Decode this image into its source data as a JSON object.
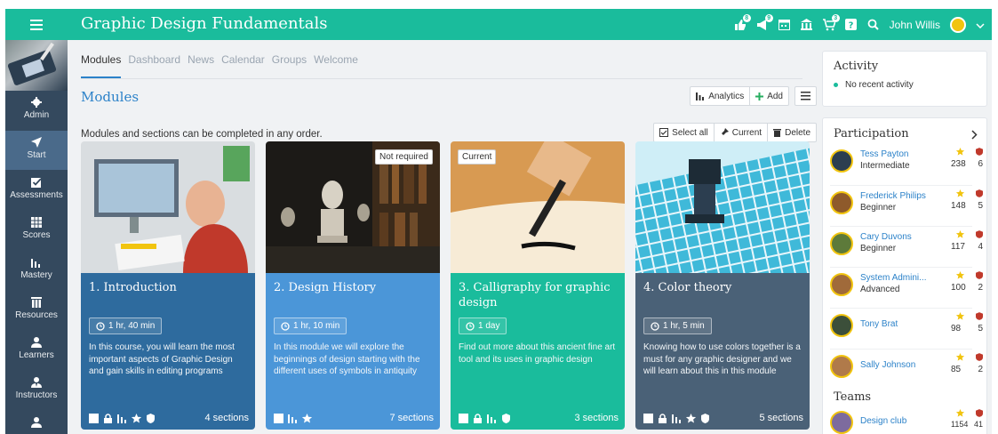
{
  "header": {
    "app_title": "Graphic Design Fundamentals",
    "icon_badges": [
      "8",
      "9",
      "",
      "",
      "3",
      ""
    ],
    "user_name": "John Willis"
  },
  "sidebar": {
    "items": [
      {
        "label": "Admin",
        "icon": "gear-icon"
      },
      {
        "label": "Start",
        "icon": "paper-plane-icon"
      },
      {
        "label": "Assessments",
        "icon": "checkbox-icon"
      },
      {
        "label": "Scores",
        "icon": "table-icon"
      },
      {
        "label": "Mastery",
        "icon": "bar-chart-icon"
      },
      {
        "label": "Resources",
        "icon": "books-icon"
      },
      {
        "label": "Learners",
        "icon": "person-icon"
      },
      {
        "label": "Instructors",
        "icon": "instructor-icon"
      }
    ],
    "active": "Start"
  },
  "tabs": [
    "Modules",
    "Dashboard",
    "News",
    "Calendar",
    "Groups",
    "Welcome"
  ],
  "main": {
    "section_title": "Modules",
    "description": "Modules and sections can be completed in any order.",
    "toolbar": {
      "analytics": "Analytics",
      "add": "Add"
    },
    "select_bar": {
      "select_all": "Select all",
      "current": "Current",
      "delete": "Delete"
    }
  },
  "cards": [
    {
      "title": "1. Introduction",
      "duration": "1 hr, 40 min",
      "text": "In this course, you will learn the most important aspects of Graphic Design and gain skills in editing programs",
      "sections": "4 sections",
      "tag": "",
      "color": "#2e6b9e"
    },
    {
      "title": "2. Design History",
      "duration": "1 hr, 10 min",
      "text": "In this module we will explore the beginnings of design starting with the different uses of symbols in antiquity",
      "sections": "7 sections",
      "tag": "Not required",
      "color": "#4b96d8"
    },
    {
      "title": "3. Calligraphy for graphic design",
      "duration": "1 day",
      "text": "Find out more about this ancient fine art tool and its uses in graphic design",
      "sections": "3 sections",
      "tag": "Current",
      "color": "#1abc9c"
    },
    {
      "title": "4. Color theory",
      "duration": "1 hr, 5 min",
      "text": "Knowing how to use colors together is a must for any graphic designer and we will learn about this in this module",
      "sections": "5 sections",
      "tag": "",
      "color": "#4a6177"
    }
  ],
  "activity": {
    "title": "Activity",
    "item": "No recent activity"
  },
  "participation": {
    "title": "Participation",
    "people": [
      {
        "name": "Tess Payton",
        "level": "Intermediate",
        "stars": "238",
        "badges": "6"
      },
      {
        "name": "Frederick Philips",
        "level": "Beginner",
        "stars": "148",
        "badges": "5"
      },
      {
        "name": "Cary Duvons",
        "level": "Beginner",
        "stars": "117",
        "badges": "4"
      },
      {
        "name": "System Admini...",
        "level": "Advanced",
        "stars": "100",
        "badges": "2"
      },
      {
        "name": "Tony Brat",
        "level": "",
        "stars": "98",
        "badges": "5"
      },
      {
        "name": "Sally Johnson",
        "level": "",
        "stars": "85",
        "badges": "2"
      }
    ]
  },
  "teams": {
    "title": "Teams",
    "items": [
      {
        "name": "Design club",
        "stars": "1154",
        "badges": "41"
      }
    ]
  },
  "colors": {
    "accent": "#1abc9c",
    "sidebar": "#34495e",
    "link": "#2c82c9",
    "star": "#f1c40f",
    "badge": "#c0392b"
  }
}
